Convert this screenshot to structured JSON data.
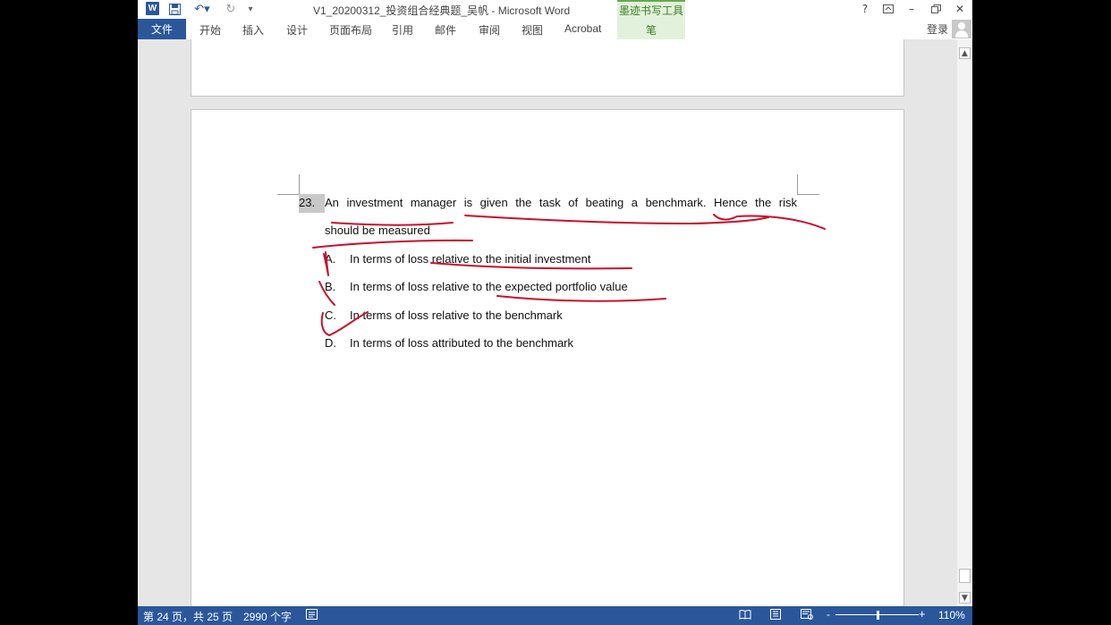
{
  "window": {
    "title": "V1_20200312_投资组合经典题_吴帆 - Microsoft Word",
    "help": "?",
    "minimize": "–",
    "close": "✕"
  },
  "ribbon": {
    "file": "文件",
    "tabs": [
      "开始",
      "插入",
      "设计",
      "页面布局",
      "引用",
      "邮件",
      "审阅",
      "视图",
      "Acrobat"
    ],
    "ink_tools_label": "墨迹书写工具",
    "ink_pen_tab": "笔",
    "login": "登录"
  },
  "document": {
    "question_number": "23.",
    "question_line1": "An investment manager is given the task of beating a benchmark. Hence the risk",
    "question_line2": "should be measured",
    "options": [
      {
        "letter": "A.",
        "text": "In terms of loss relative to the initial investment"
      },
      {
        "letter": "B.",
        "text": "In terms of loss relative to the expected portfolio value"
      },
      {
        "letter": "C.",
        "text": "In terms of loss relative to the benchmark"
      },
      {
        "letter": "D.",
        "text": "In terms of loss attributed to the benchmark"
      }
    ],
    "ink_color": "#c8102e"
  },
  "statusbar": {
    "page_info": "第 24 页，共 25 页",
    "word_count": "2990 个字",
    "zoom": "110%",
    "zoom_minus": "-",
    "zoom_plus": "+"
  },
  "colors": {
    "accent": "#2b579a",
    "ink_group": "#e2f1dc"
  }
}
